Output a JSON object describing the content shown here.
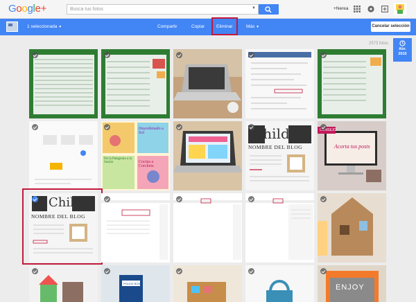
{
  "header": {
    "logo_text": "Google",
    "logo_plus": "+",
    "search_placeholder": "Busca tus fotos",
    "user_name": "+Nerea"
  },
  "actionbar": {
    "selection_label": "1 seleccionada",
    "share_label": "Compartir",
    "copy_label": "Copiar",
    "delete_label": "Eliminar",
    "more_label": "Más",
    "cancel_label": "Cancelar selección"
  },
  "gallery": {
    "photo_count": "2573 fotos",
    "date_month": "Abr.",
    "date_year": "2015",
    "tile_texts": {
      "child": "Child",
      "blog_name": "NOMBRE DEL BLOG",
      "consejo": "CONSEJO",
      "acorta": "Acorta tus posts",
      "desordenado": "Desordenado a Sol",
      "patagonia": "De la Patagonia a la Sesión",
      "cocina": "Cocina a Corcheta",
      "enjoy": "ENJOY",
      "police": "POLICE BOX"
    }
  },
  "colors": {
    "accent": "#4285f4",
    "highlight": "#c2183b",
    "background": "#ececec"
  }
}
